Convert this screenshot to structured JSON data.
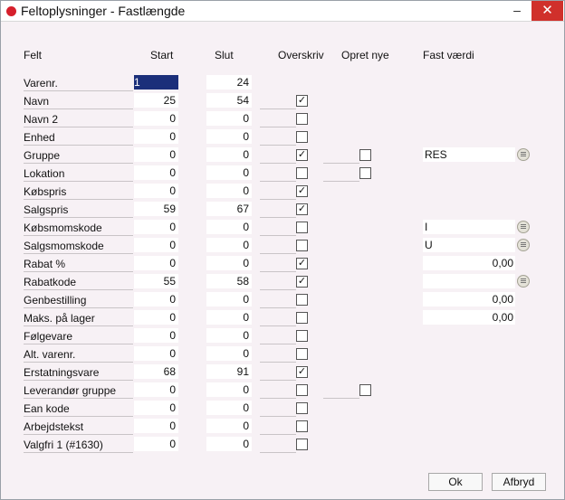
{
  "window": {
    "title": "Feltoplysninger - Fastlængde",
    "min_glyph": "–",
    "close_glyph": "✕"
  },
  "headers": {
    "felt": "Felt",
    "start": "Start",
    "slut": "Slut",
    "overskriv": "Overskriv",
    "opret_nye": "Opret nye",
    "fast_vaerdi": "Fast værdi"
  },
  "rows": [
    {
      "label": "Varenr.",
      "start": "1",
      "slut": "24",
      "overskriv": null,
      "opret": null,
      "fast": null
    },
    {
      "label": "Navn",
      "start": "25",
      "slut": "54",
      "overskriv": true,
      "opret": null,
      "fast": null
    },
    {
      "label": "Navn 2",
      "start": "0",
      "slut": "0",
      "overskriv": false,
      "opret": null,
      "fast": null
    },
    {
      "label": "Enhed",
      "start": "0",
      "slut": "0",
      "overskriv": false,
      "opret": null,
      "fast": null
    },
    {
      "label": "Gruppe",
      "start": "0",
      "slut": "0",
      "overskriv": true,
      "opret": false,
      "fast": "RES",
      "lookup": true
    },
    {
      "label": "Lokation",
      "start": "0",
      "slut": "0",
      "overskriv": false,
      "opret": false,
      "fast": null
    },
    {
      "label": "Købspris",
      "start": "0",
      "slut": "0",
      "overskriv": true,
      "opret": null,
      "fast": null
    },
    {
      "label": "Salgspris",
      "start": "59",
      "slut": "67",
      "overskriv": true,
      "opret": null,
      "fast": null
    },
    {
      "label": "Købsmomskode",
      "start": "0",
      "slut": "0",
      "overskriv": false,
      "opret": null,
      "fast": "I",
      "lookup": true
    },
    {
      "label": "Salgsmomskode",
      "start": "0",
      "slut": "0",
      "overskriv": false,
      "opret": null,
      "fast": "U",
      "lookup": true
    },
    {
      "label": "Rabat %",
      "start": "0",
      "slut": "0",
      "overskriv": true,
      "opret": null,
      "fast": "0,00",
      "numeric": true
    },
    {
      "label": "Rabatkode",
      "start": "55",
      "slut": "58",
      "overskriv": true,
      "opret": null,
      "fast": "",
      "lookup": true
    },
    {
      "label": "Genbestilling",
      "start": "0",
      "slut": "0",
      "overskriv": false,
      "opret": null,
      "fast": "0,00",
      "numeric": true
    },
    {
      "label": "Maks. på lager",
      "start": "0",
      "slut": "0",
      "overskriv": false,
      "opret": null,
      "fast": "0,00",
      "numeric": true
    },
    {
      "label": "Følgevare",
      "start": "0",
      "slut": "0",
      "overskriv": false,
      "opret": null,
      "fast": null
    },
    {
      "label": "Alt. varenr.",
      "start": "0",
      "slut": "0",
      "overskriv": false,
      "opret": null,
      "fast": null
    },
    {
      "label": "Erstatningsvare",
      "start": "68",
      "slut": "91",
      "overskriv": true,
      "opret": null,
      "fast": null
    },
    {
      "label": "Leverandør gruppe",
      "start": "0",
      "slut": "0",
      "overskriv": false,
      "opret": false,
      "fast": null
    },
    {
      "label": "Ean kode",
      "start": "0",
      "slut": "0",
      "overskriv": false,
      "opret": null,
      "fast": null
    },
    {
      "label": "Arbejdstekst",
      "start": "0",
      "slut": "0",
      "overskriv": false,
      "opret": null,
      "fast": null
    },
    {
      "label": "Valgfri 1 (#1630)",
      "start": "0",
      "slut": "0",
      "overskriv": false,
      "opret": null,
      "fast": null
    }
  ],
  "buttons": {
    "ok": "Ok",
    "cancel": "Afbryd"
  },
  "colors": {
    "close_bg": "#d0302b",
    "app_dot": "#d6202c",
    "selection": "#1b2f7a"
  }
}
